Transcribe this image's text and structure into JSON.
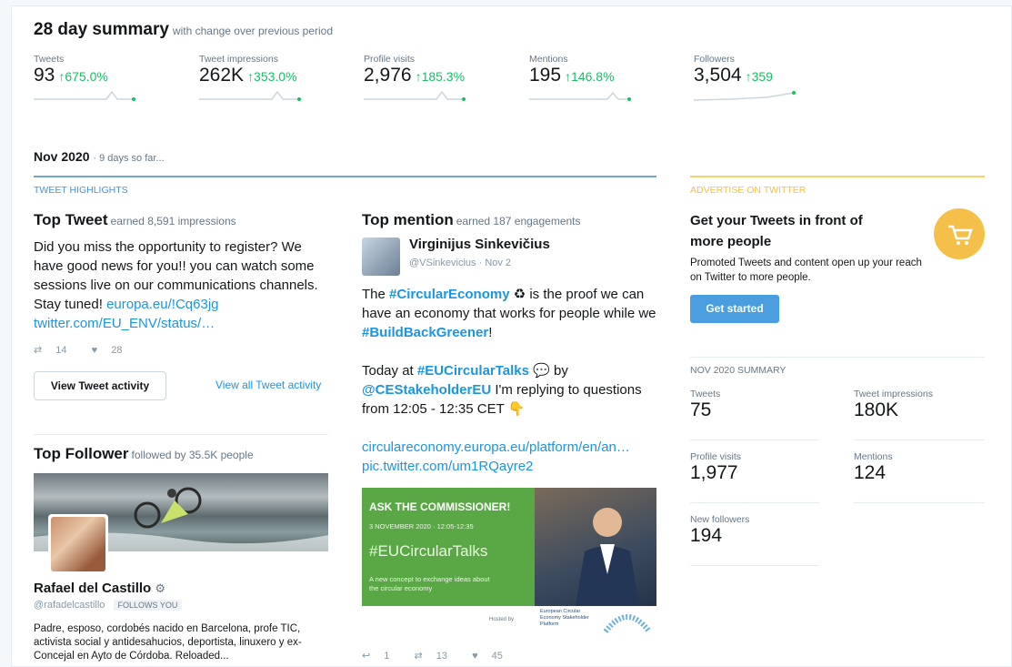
{
  "summary": {
    "title": "28 day summary",
    "subtitle": "with change over previous period",
    "metrics": [
      {
        "label": "Tweets",
        "value": "93",
        "change": "675.0%"
      },
      {
        "label": "Tweet impressions",
        "value": "262K",
        "change": "353.0%"
      },
      {
        "label": "Profile visits",
        "value": "2,976",
        "change": "185.3%"
      },
      {
        "label": "Mentions",
        "value": "195",
        "change": "146.8%"
      },
      {
        "label": "Followers",
        "value": "3,504",
        "change": "359"
      }
    ],
    "up_arrow": "↑"
  },
  "month": {
    "title": "Nov 2020",
    "subtitle": "· 9 days so far..."
  },
  "highlights": {
    "section_label": "TWEET HIGHLIGHTS",
    "top_tweet": {
      "heading": "Top Tweet",
      "sub": "earned 8,591 impressions",
      "text": "Did you miss the opportunity to register? We have good news for you!! you can watch some sessions live on our communications channels. Stay tuned!",
      "link1": "europa.eu/!Cq63jg",
      "link2": "twitter.com/EU_ENV/status/…",
      "retweets": "14",
      "likes": "28",
      "view_button": "View Tweet activity",
      "view_all": "View all Tweet activity"
    },
    "top_follower": {
      "heading": "Top Follower",
      "sub": "followed by 35.5K people",
      "name": "Rafael del Castillo",
      "handle": "@rafadelcastillo",
      "follows_you": "FOLLOWS YOU",
      "bio": "Padre, esposo, cordobés nacido en Barcelona, profe TIC, activista social y antidesahucios, deportista, linuxero y ex-Concejal en Ayto de Córdoba. Reloaded..."
    },
    "top_mention": {
      "heading": "Top mention",
      "sub": "earned 187 engagements",
      "name": "Virginijus Sinkevičius",
      "handle": "@VSinkevicius",
      "date": "· Nov 2",
      "p1_a": "The ",
      "p1_hash": "#CircularEconomy",
      "p1_b": " ♻ is the proof we can have an economy that works for people while we ",
      "p1_hash2": "#BuildBackGreener",
      "p1_c": "!",
      "p2_a": "Today at ",
      "p2_hash": "#EUCircularTalks",
      "p2_b": " 💬 by ",
      "p2_mention": "@CEStakeholderEU",
      "p2_c": " I'm replying to questions from 12:05 - 12:35 CET 👇",
      "link1": "circulareconomy.europa.eu/platform/en/an…",
      "link2": "pic.twitter.com/um1RQayre2",
      "image": {
        "heading": "ASK THE COMMISSIONER!",
        "date": "3 NOVEMBER 2020 · 12:05-12:35",
        "hashtag": "#EUCircularTalks",
        "desc": "A new concept to exchange ideas about the circular economy",
        "hosted": "Hosted by",
        "platform": "European Circular Economy Stakeholder Platform"
      },
      "replies": "1",
      "retweets": "13",
      "likes": "45"
    }
  },
  "advertise": {
    "label": "ADVERTISE ON TWITTER",
    "heading": "Get your Tweets in front of more people",
    "body": "Promoted Tweets and content open up your reach on Twitter to more people.",
    "button": "Get started"
  },
  "nov_summary": {
    "label": "NOV 2020 SUMMARY",
    "stats": [
      {
        "label": "Tweets",
        "value": "75"
      },
      {
        "label": "Tweet impressions",
        "value": "180K"
      },
      {
        "label": "Profile visits",
        "value": "1,977"
      },
      {
        "label": "Mentions",
        "value": "124"
      },
      {
        "label": "New followers",
        "value": "194"
      }
    ]
  },
  "colors": {
    "accent": "#1b95e0",
    "positive": "#17bf63",
    "gold": "#f5c04a",
    "button": "#4a9ee0"
  }
}
